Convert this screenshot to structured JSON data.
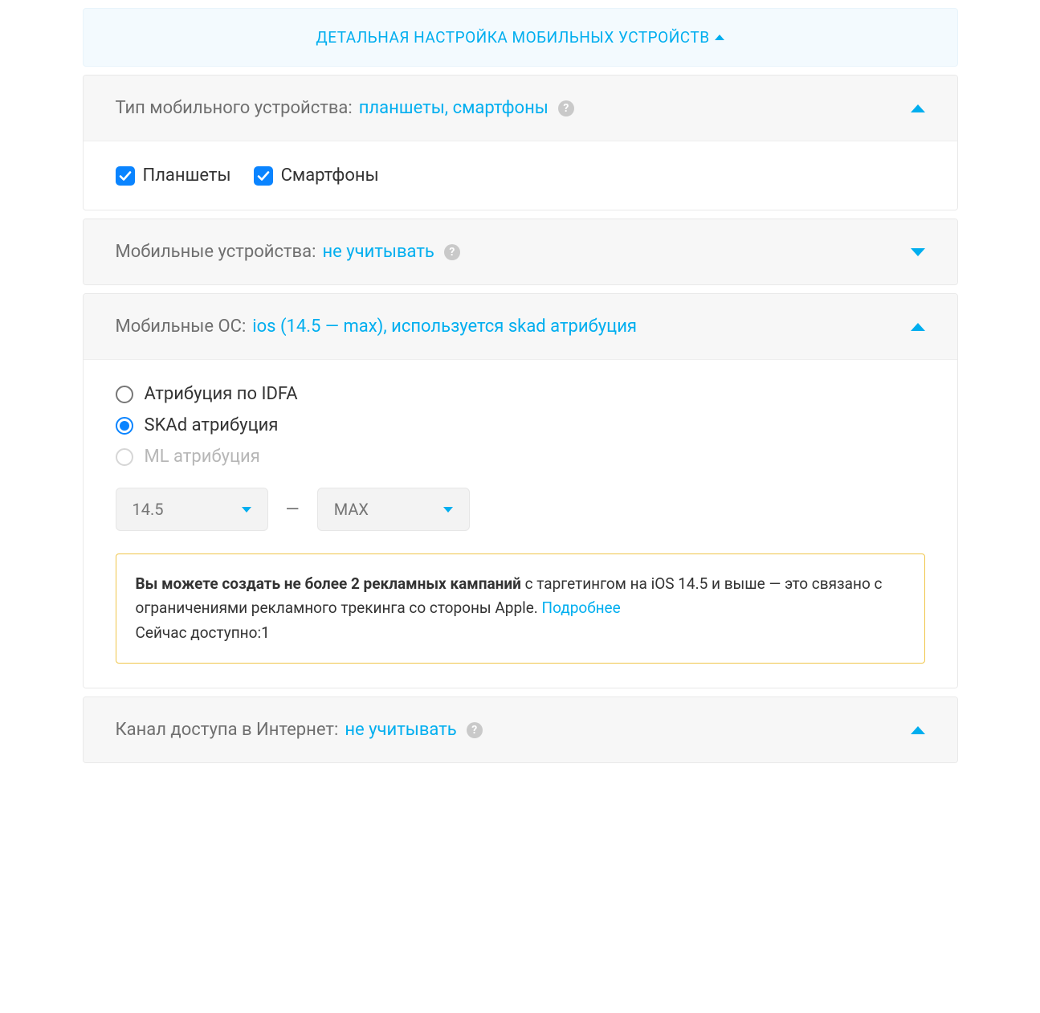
{
  "banner": {
    "label": "ДЕТАЛЬНАЯ НАСТРОЙКА МОБИЛЬНЫХ УСТРОЙСТВ"
  },
  "panels": {
    "device_type": {
      "label": "Тип мобильного устройства:",
      "value": "планшеты, смартфоны",
      "checkboxes": {
        "tablets": {
          "label": "Планшеты",
          "checked": true
        },
        "smartphones": {
          "label": "Смартфоны",
          "checked": true
        }
      }
    },
    "mobile_devices": {
      "label": "Мобильные устройства:",
      "value": "не учитывать"
    },
    "mobile_os": {
      "label": "Мобильные ОС:",
      "value": "ios (14.5 — max), используется skad атрибуция",
      "radios": {
        "idfa": {
          "label": "Атрибуция по IDFA",
          "selected": false,
          "disabled": false
        },
        "skad": {
          "label": "SKAd атрибуция",
          "selected": true,
          "disabled": false
        },
        "ml": {
          "label": "ML атрибуция",
          "selected": false,
          "disabled": true
        }
      },
      "version_from": "14.5",
      "version_separator": "—",
      "version_to": "MAX",
      "warning": {
        "bold": "Вы можете создать не более 2 рекламных кампаний",
        "rest1": " с таргетингом на iOS 14.5 и выше — это связано с ограничениями рекламного трекинга со стороны Apple. ",
        "link": "Подробнее",
        "line2": "Сейчас доступно:1"
      }
    },
    "internet_channel": {
      "label": "Канал доступа в Интернет:",
      "value": "не учитывать"
    }
  }
}
